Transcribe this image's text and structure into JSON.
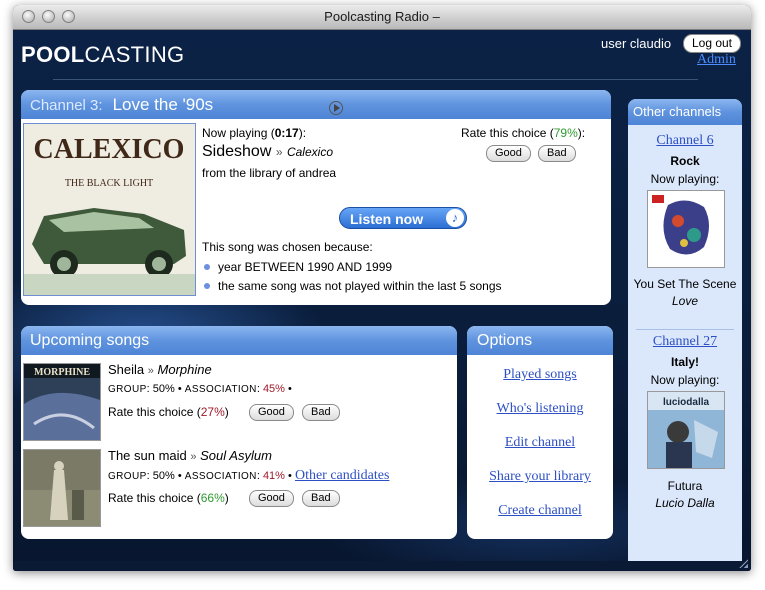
{
  "window": {
    "title": "Poolcasting Radio –"
  },
  "header": {
    "logo_bold": "POOL",
    "logo_light": "CASTING",
    "user_text": "user claudio",
    "logout_label": "Log out",
    "admin_label": "Admin"
  },
  "channel": {
    "prefix": "Channel 3:",
    "name": "Love the '90s",
    "now_playing_label": "Now playing (",
    "time": "0:17",
    "now_playing_suffix": "):",
    "song": "Sideshow",
    "sep": "»",
    "artist": "Calexico",
    "from_library": "from the library of andrea",
    "rate_label": "Rate this choice (",
    "rate_pct": "79%",
    "rate_suffix": "):",
    "good": "Good",
    "bad": "Bad",
    "listen_label": "Listen now",
    "reason_title": "This song was chosen because:",
    "reasons": [
      "year BETWEEN 1990 AND 1999",
      "the same song was not played within the last 5 songs"
    ],
    "cover": {
      "title": "CALEXICO",
      "subtitle": "THE BLACK LIGHT"
    }
  },
  "upcoming": {
    "title": "Upcoming songs",
    "songs": [
      {
        "song": "Sheila",
        "artist": "Morphine",
        "group_label": "GROUP",
        "group_pct": "50%",
        "assoc_label": "ASSOCIATION",
        "assoc_pct": "45%",
        "tail": "•",
        "rate_label": "Rate this choice (",
        "rate_pct": "27%",
        "rate_suffix": ")",
        "good": "Good",
        "bad": "Bad",
        "cover_text": "MORPHINE"
      },
      {
        "song": "The sun maid",
        "artist": "Soul Asylum",
        "group_label": "GROUP",
        "group_pct": "50%",
        "assoc_label": "ASSOCIATION",
        "assoc_pct": "41%",
        "tail": "•",
        "other_link": "Other candidates",
        "rate_label": "Rate this choice (",
        "rate_pct": "66%",
        "rate_suffix": ")",
        "good": "Good",
        "bad": "Bad"
      }
    ]
  },
  "options": {
    "title": "Options",
    "items": [
      "Played songs",
      "Who's listening",
      "Edit channel",
      "Share your library",
      "Create channel"
    ]
  },
  "other_channels": {
    "title": "Other channels",
    "channels": [
      {
        "link": "Channel 6",
        "name": "Rock",
        "now_playing": "Now playing:",
        "song": "You Set The Scene",
        "artist": "Love"
      },
      {
        "link": "Channel 27",
        "name": "Italy!",
        "now_playing": "Now playing:",
        "song": "Futura",
        "artist": "Lucio Dalla",
        "cover_text": "luciodalla"
      }
    ]
  },
  "colors": {
    "accent": "#5f93de",
    "red": "#a11a2a",
    "green": "#2f9a2f",
    "link": "#2d4fc4"
  }
}
